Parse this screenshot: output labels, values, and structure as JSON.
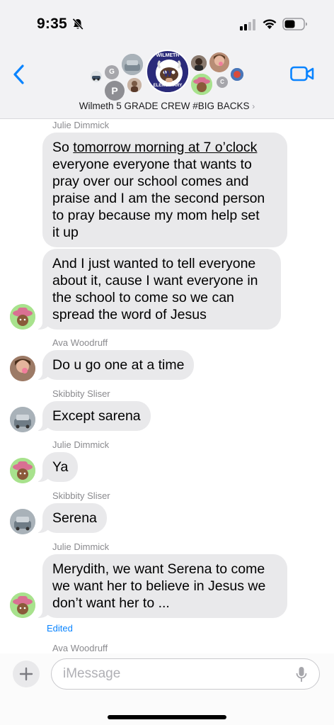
{
  "status_bar": {
    "time": "9:35",
    "icons": [
      "bell-slash-icon",
      "cellular-signal-icon",
      "wifi-icon",
      "battery-icon"
    ]
  },
  "header": {
    "group_name": "Wilmeth 5 GRADE  CREW #BIG BACKS",
    "chevron": "›",
    "group_badge": {
      "top_text": "WILMETH",
      "bottom_text": "ELEMENTARY",
      "letter": "W"
    },
    "member_initials": [
      "G",
      "P",
      "C"
    ],
    "icons": [
      "chevron-left-icon",
      "video-camera-icon"
    ]
  },
  "colors": {
    "accent": "#0a84ff",
    "bubble": "#e9e9eb",
    "sender": "#8a8a8e",
    "badge_navy": "#2b2b7a",
    "avatar_green": "#a8e28d"
  },
  "messages": [
    {
      "sender": "Julie Dimmick",
      "bubbles": [
        {
          "lines": [
            "So |tomorrow morning at 7 o’clock",
            "everyone everyone that wants to",
            "pray over our school comes and",
            "praise and I am the second person",
            "to pray because my mom help set",
            "it up"
          ],
          "underlined": "tomorrow morning at 7 o’clock"
        },
        {
          "lines": [
            "And I just wanted to tell everyone",
            "about it, cause I want everyone in",
            "the school to come so we can",
            "spread the word of Jesus"
          ]
        }
      ],
      "avatar": "cowboy-hat-memoji"
    },
    {
      "sender": "Ava Woodruff",
      "bubbles": [
        {
          "lines": [
            "Do u go one at a time"
          ]
        }
      ],
      "avatar": "selfie-photo"
    },
    {
      "sender": "Skibbity Sliser",
      "bubbles": [
        {
          "lines": [
            "Except sarena"
          ]
        }
      ],
      "avatar": "car-photo"
    },
    {
      "sender": "Julie Dimmick",
      "bubbles": [
        {
          "lines": [
            "Ya"
          ]
        }
      ],
      "avatar": "cowboy-hat-memoji"
    },
    {
      "sender": "Skibbity Sliser",
      "bubbles": [
        {
          "lines": [
            "Serena"
          ]
        }
      ],
      "avatar": "car-photo"
    },
    {
      "sender": "Julie Dimmick",
      "bubbles": [
        {
          "lines": [
            "Merydith, we want Serena to come",
            "we want her to believe in Jesus we",
            "don’t want her to ..."
          ]
        }
      ],
      "avatar": "cowboy-hat-memoji",
      "edited_label": "Edited"
    },
    {
      "sender": "Ava Woodruff",
      "bubbles": []
    }
  ],
  "compose": {
    "placeholder": "iMessage",
    "icons": [
      "plus-icon",
      "microphone-icon"
    ]
  }
}
